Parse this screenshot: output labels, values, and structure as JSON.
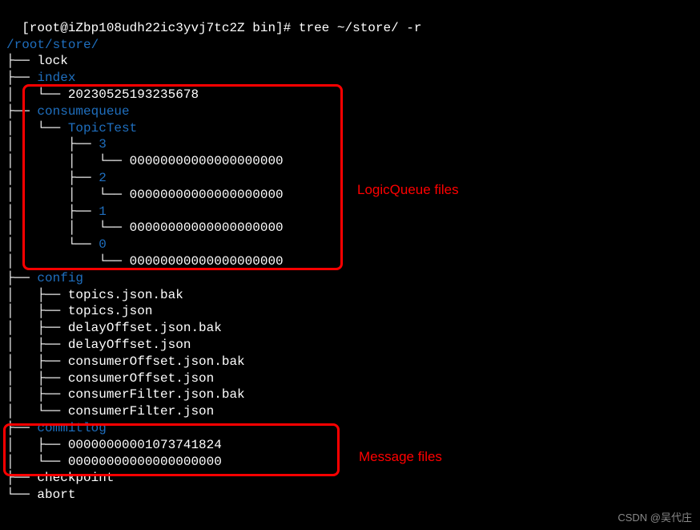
{
  "prompt": {
    "user_host": "[root@iZbp108udh22ic3yvj7tc2Z bin]#",
    "command": "tree ~/store/ -r"
  },
  "root_path": "/root/store/",
  "tree": {
    "lock": "lock",
    "index": "index",
    "index_file": "20230525193235678",
    "consumequeue": "consumequeue",
    "topictest": "TopicTest",
    "q3": "3",
    "q2": "2",
    "q1": "1",
    "q0": "0",
    "zeros": "00000000000000000000",
    "config": "config",
    "config_files": {
      "f1": "topics.json.bak",
      "f2": "topics.json",
      "f3": "delayOffset.json.bak",
      "f4": "delayOffset.json",
      "f5": "consumerOffset.json.bak",
      "f6": "consumerOffset.json",
      "f7": "consumerFilter.json.bak",
      "f8": "consumerFilter.json"
    },
    "commitlog": "commitlog",
    "commitlog_files": {
      "f1": "00000000001073741824",
      "f2": "00000000000000000000"
    },
    "checkpoint": "checkpoint",
    "abort": "abort"
  },
  "annotations": {
    "logic_queue": "LogicQueue files",
    "message_files": "Message files"
  },
  "watermark": "CSDN @吴代庄"
}
